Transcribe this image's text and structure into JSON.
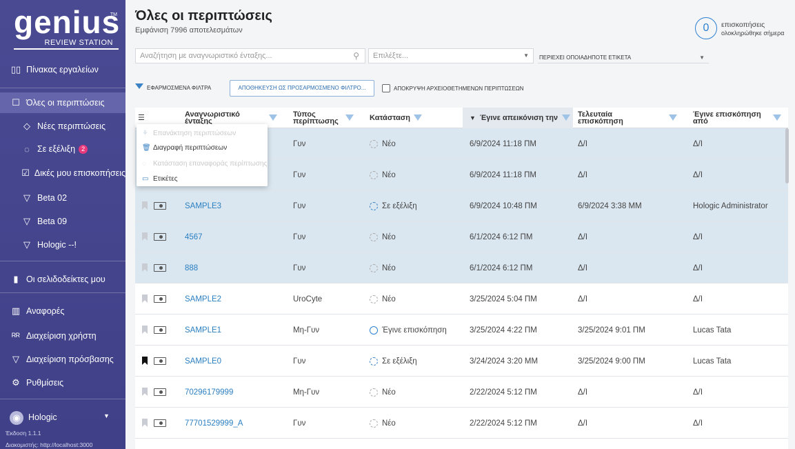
{
  "logo": {
    "word": "genius",
    "tm": "TM",
    "sub": "REVIEW STATION"
  },
  "sidebar": {
    "dashboard": {
      "label": "Πίνακας εργαλείων",
      "icon": "dashboard-icon"
    },
    "all_cases": {
      "label": "Όλες οι περιπτώσεις",
      "icon": "folder-icon"
    },
    "sub_items": [
      {
        "label": "Νέες περιπτώσεις",
        "icon": "tag-icon"
      },
      {
        "label": "Σε εξέλιξη",
        "icon": "in-progress-icon",
        "badge": "2"
      },
      {
        "label": "Δικές μου επισκοπήσεις",
        "icon": "check-box-icon"
      },
      {
        "label": "Beta 02",
        "icon": "filter-icon"
      },
      {
        "label": "Beta 09",
        "icon": "filter-icon"
      },
      {
        "label": "Hologic --!",
        "icon": "filter-icon"
      }
    ],
    "bookmarks": {
      "label": "Οι σελιδοδείκτες μου",
      "icon": "bookmark-icon"
    },
    "reports": {
      "label": "Αναφορές",
      "icon": "chart-icon"
    },
    "user_mgmt": {
      "label": "Διαχείριση χρήστη",
      "icon": "users-icon"
    },
    "access_mgmt": {
      "label": "Διαχείριση πρόσβασης",
      "icon": "access-icon"
    },
    "settings": {
      "label": "Ρυθμίσεις",
      "icon": "gear-icon"
    },
    "user": {
      "name": "Hologic",
      "version": "Έκδοση 1.1.1",
      "server": "Διακομιστής: http://localhost:3000"
    }
  },
  "header": {
    "title": "Όλες οι περιπτώσεις",
    "subtitle": "Εμφάνιση 7996 αποτελεσμάτων",
    "counter": "0",
    "counter_label1": "επισκοπήσεις",
    "counter_label2": "ολοκληρώθηκε σήμερα"
  },
  "filters": {
    "search_placeholder": "Αναζήτηση με αναγνωριστικό ένταξης...",
    "select_placeholder": "Επιλέξτε...",
    "tag_select": "ΠΕΡΙΕΧΕΙ ΟΠΟΙΑΔΗΠΟΤΕ ΕΤΙΚΕΤΑ",
    "applied_label": "ΕΦΑΡΜΟΣΜΕΝΑ ΦΙΛΤΡΑ",
    "save_filter": "ΑΠΟΘΗΚΕΥΣΗ ΩΣ ΠΡΟΣΑΡΜΟΣΜΕΝΟ ΦΙΛΤΡΟ...",
    "hide_archived": "ΑΠΟΚΡΥΨΗ ΑΡΧΕΙΟΘΕΤΗΜΕΝΩΝ ΠΕΡΙΠΤΩΣΕΩΝ"
  },
  "table": {
    "headers": {
      "id": "Αναγνωριστικό ένταξης",
      "type": "Τύπος περίπτωσης",
      "status": "Κατάσταση",
      "imaged": "Έγινε απεικόνιση την",
      "last_review": "Τελευταία επισκόπηση",
      "reviewed_by": "Έγινε επισκόπηση από"
    },
    "sort_arrow": "▼",
    "rows": [
      {
        "id": "",
        "type": "Γυν",
        "status": "Νέο",
        "imaged": "6/9/2024 11:18 ΠΜ",
        "last": "Δ/Ι",
        "by": "Δ/Ι",
        "sel": true,
        "bm": "light",
        "status_kind": "new"
      },
      {
        "id": "",
        "type": "Γυν",
        "status": "Νέο",
        "imaged": "6/9/2024 11:18 ΠΜ",
        "last": "Δ/Ι",
        "by": "Δ/Ι",
        "sel": true,
        "bm": "light",
        "status_kind": "new"
      },
      {
        "id": "SAMPLE3",
        "type": "Γυν",
        "status": "Σε εξέλιξη",
        "imaged": "6/9/2024 10:48 ΠΜ",
        "last": "6/9/2024 3:38 ΜΜ",
        "by": "Hologic Administrator",
        "sel": true,
        "bm": "light",
        "status_kind": "prog"
      },
      {
        "id": "4567",
        "type": "Γυν",
        "status": "Νέο",
        "imaged": "6/1/2024 6:12 ΠΜ",
        "last": "Δ/Ι",
        "by": "Δ/Ι",
        "sel": true,
        "bm": "light",
        "status_kind": "new"
      },
      {
        "id": "888",
        "type": "Γυν",
        "status": "Νέο",
        "imaged": "6/1/2024 6:12 ΠΜ",
        "last": "Δ/Ι",
        "by": "Δ/Ι",
        "sel": true,
        "bm": "light",
        "status_kind": "new"
      },
      {
        "id": "SAMPLE2",
        "type": "UroCyte",
        "status": "Νέο",
        "imaged": "3/25/2024 5:04 ΠΜ",
        "last": "Δ/Ι",
        "by": "Δ/Ι",
        "sel": false,
        "bm": "light",
        "status_kind": "new"
      },
      {
        "id": "SAMPLE1",
        "type": "Μη-Γυν",
        "status": "Έγινε επισκόπηση",
        "imaged": "3/25/2024 4:22 ΠΜ",
        "last": "3/25/2024 9:01 ΠΜ",
        "by": "Lucas Tata",
        "sel": false,
        "bm": "light",
        "status_kind": "done"
      },
      {
        "id": "SAMPLE0",
        "type": "Γυν",
        "status": "Σε εξέλιξη",
        "imaged": "3/24/2024 3:20 ΜΜ",
        "last": "3/25/2024 9:00 ΠΜ",
        "by": "Lucas Tata",
        "sel": false,
        "bm": "dark",
        "status_kind": "prog"
      },
      {
        "id": "70296179999",
        "type": "Μη-Γυν",
        "status": "Νέο",
        "imaged": "2/22/2024 5:12 ΠΜ",
        "last": "Δ/Ι",
        "by": "Δ/Ι",
        "sel": false,
        "bm": "light",
        "status_kind": "new"
      },
      {
        "id": "77701529999_A",
        "type": "Γυν",
        "status": "Νέο",
        "imaged": "2/22/2024 5:12 ΠΜ",
        "last": "Δ/Ι",
        "by": "Δ/Ι",
        "sel": false,
        "bm": "light",
        "status_kind": "new"
      }
    ]
  },
  "context_menu": {
    "items": [
      {
        "label": "Επανάκτηση περιπτώσεων",
        "disabled": true,
        "icon": "restore-icon"
      },
      {
        "label": "Διαγραφή περιπτώσεων",
        "disabled": false,
        "icon": "trash-icon"
      },
      {
        "label": "Κατάσταση επαναφοράς περίπτωσης",
        "disabled": true,
        "icon": "reset-status-icon"
      },
      {
        "label": "Ετικέτες",
        "disabled": false,
        "icon": "tag-label-icon"
      }
    ]
  },
  "colors": {
    "sidebar": "#4a4a93",
    "accent": "#2b7fd4",
    "selected_row": "#dbe7f0",
    "badge": "#e8397d"
  }
}
